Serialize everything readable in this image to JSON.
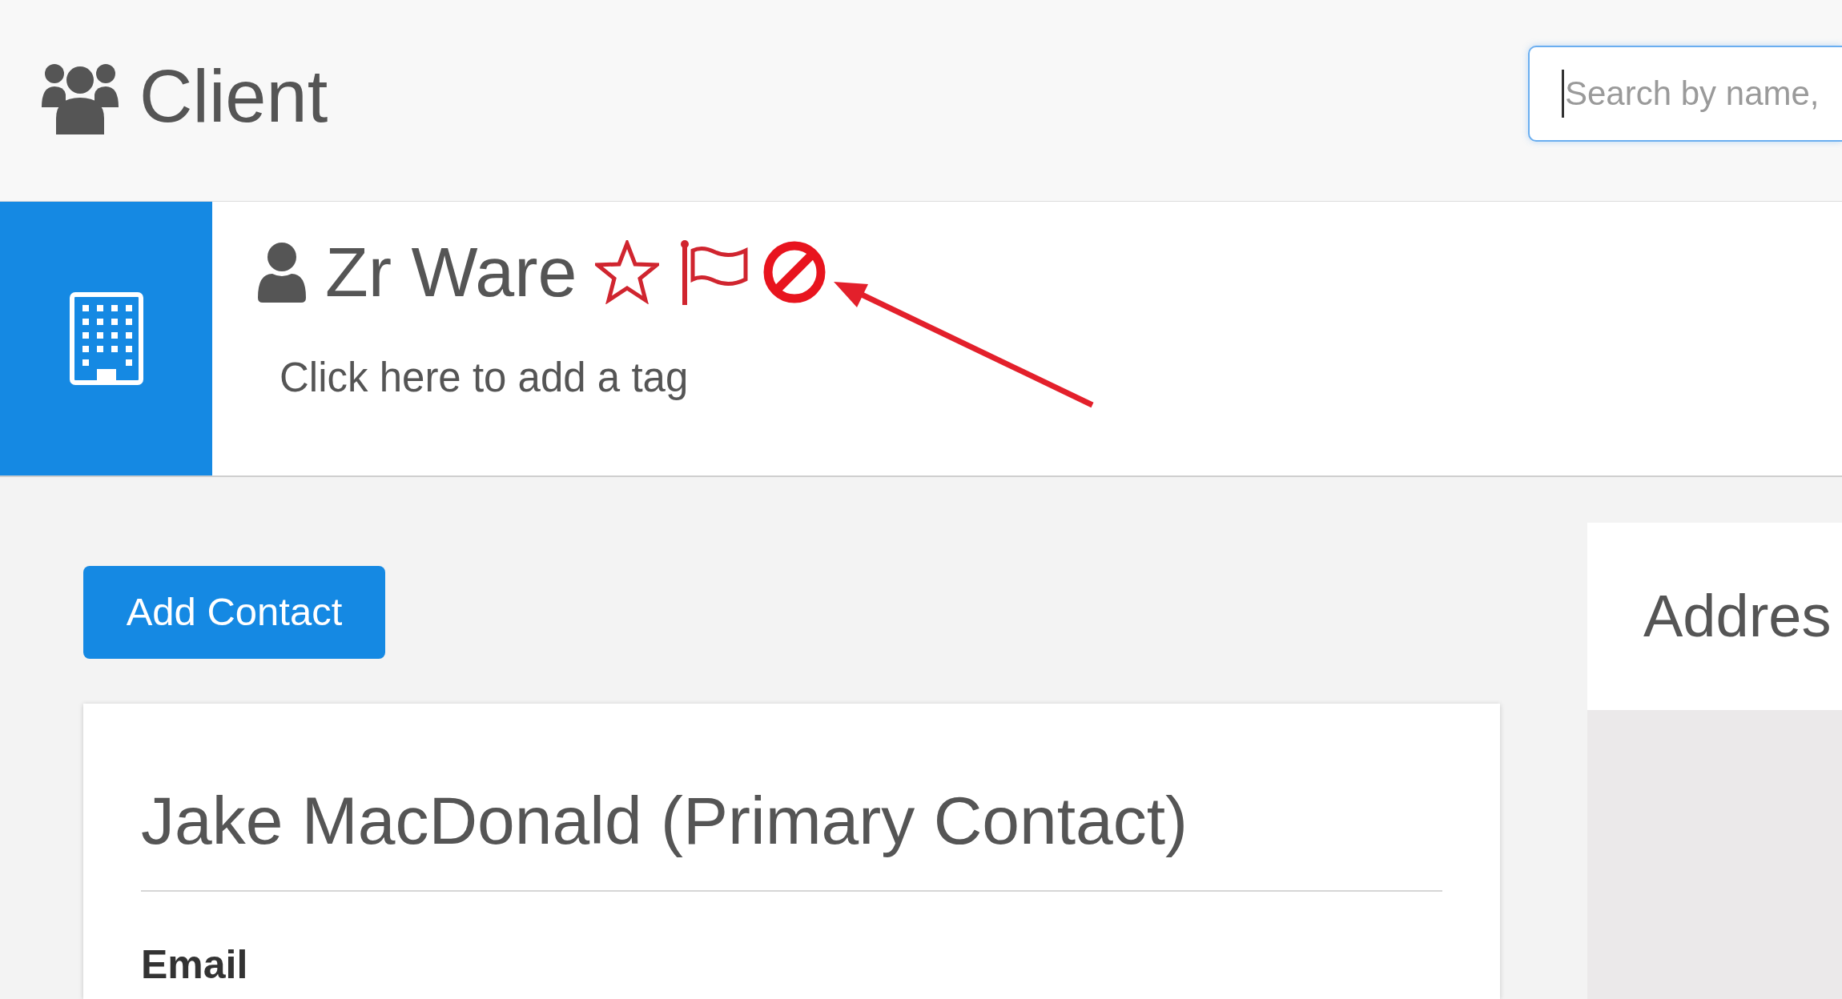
{
  "header": {
    "title": "Client",
    "search": {
      "placeholder": "Search by name,"
    }
  },
  "client": {
    "name": "Zr Ware",
    "favorite": false,
    "flagged": false,
    "blocked": true,
    "tag_prompt": "Click here to add a tag"
  },
  "actions": {
    "add_contact": "Add Contact"
  },
  "contacts": [
    {
      "heading": "Jake MacDonald (Primary Contact)",
      "fields": [
        {
          "label": "Email"
        }
      ]
    }
  ],
  "address_panel": {
    "title": "Addres"
  }
}
